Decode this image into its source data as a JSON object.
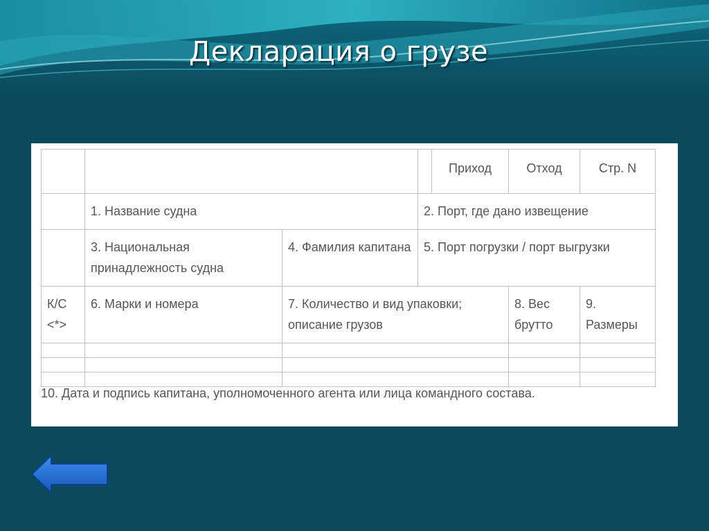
{
  "slide": {
    "title": "Декларация о грузе"
  },
  "form": {
    "header": {
      "arrival": "Приход",
      "departure": "Отход",
      "page": "Стр. N"
    },
    "fields": {
      "f1": "1. Название судна",
      "f2": "2. Порт, где дано извещение",
      "f3": "3. Национальная принадлежность судна",
      "f4": "4. Фамилия капитана",
      "f5": "5. Порт погрузки / порт выгрузки",
      "kc": "К/С <*>",
      "f6": "6. Марки и номера",
      "f7": "7. Количество и вид упаковки; описание грузов",
      "f8": "8. Вес брутто",
      "f9": "9. Размеры"
    },
    "footnote": "10. Дата и подпись капитана, уполномоченного агента или лица командного состава."
  },
  "nav": {
    "back_icon": "left-arrow-icon",
    "arrow_color": "#1f6fd6"
  }
}
